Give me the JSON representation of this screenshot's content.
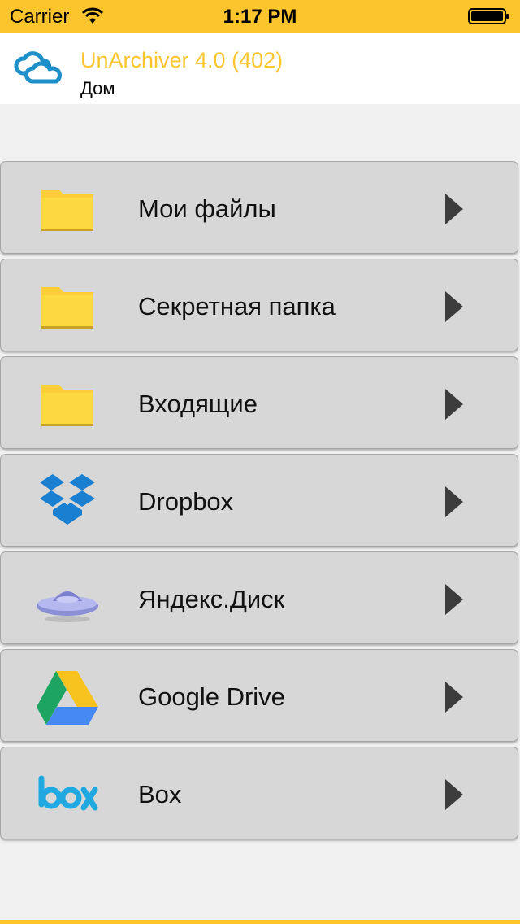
{
  "status_bar": {
    "carrier": "Carrier",
    "time": "1:17 PM"
  },
  "header": {
    "title": "UnArchiver 4.0 (402)",
    "subtitle": "Дом"
  },
  "items": [
    {
      "label": "Мои файлы",
      "icon": "folder-icon"
    },
    {
      "label": "Секретная папка",
      "icon": "folder-icon"
    },
    {
      "label": "Входящие",
      "icon": "folder-icon"
    },
    {
      "label": "Dropbox",
      "icon": "dropbox-icon"
    },
    {
      "label": "Яндекс.Диск",
      "icon": "yandex-disk-icon"
    },
    {
      "label": "Google Drive",
      "icon": "google-drive-icon"
    },
    {
      "label": "Box",
      "icon": "box-icon"
    }
  ],
  "colors": {
    "accent": "#fcc52e",
    "row_bg": "#d7d7d7",
    "logo_blue": "#1d8fc9"
  }
}
